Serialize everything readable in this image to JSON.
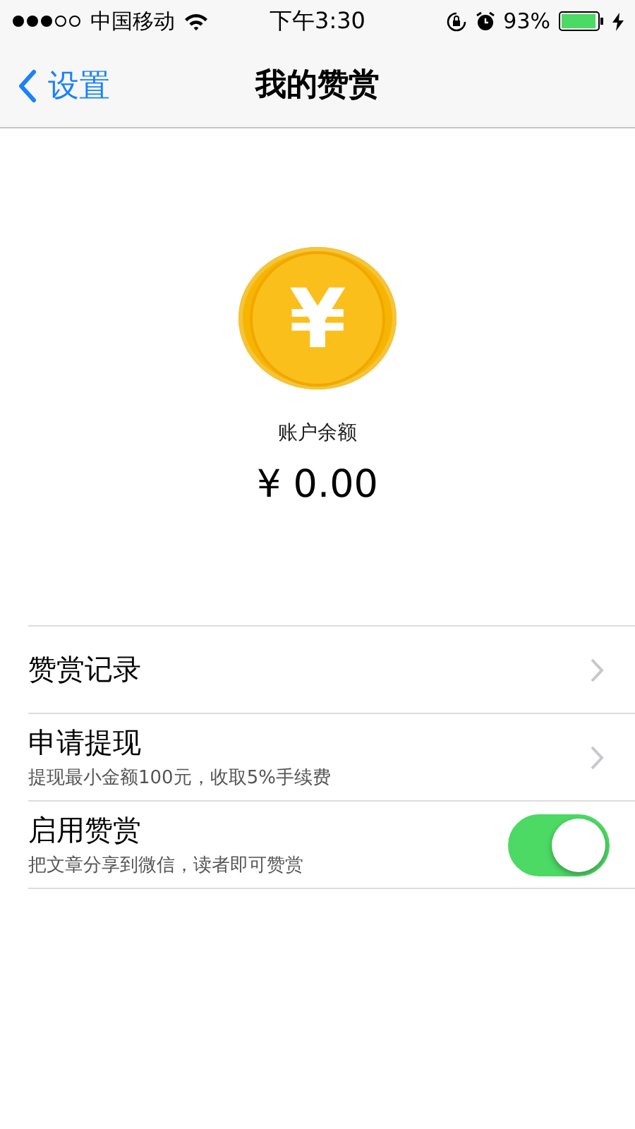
{
  "status_bar": {
    "carrier": "中国移动",
    "time": "下午3:30",
    "battery": "93%"
  },
  "nav": {
    "back": "设置",
    "title": "我的赞赏"
  },
  "balance": {
    "coin_symbol": "¥",
    "label": "账户余额",
    "amount": "¥ 0.00"
  },
  "rows": [
    {
      "kind": "link",
      "title": "赞赏记录"
    },
    {
      "kind": "link",
      "title": "申请提现",
      "subtitle": "提现最小金额100元，收取5%手续费"
    },
    {
      "kind": "toggle",
      "title": "启用赞赏",
      "subtitle": "把文章分享到微信，读者即可赞赏",
      "on": true
    }
  ]
}
